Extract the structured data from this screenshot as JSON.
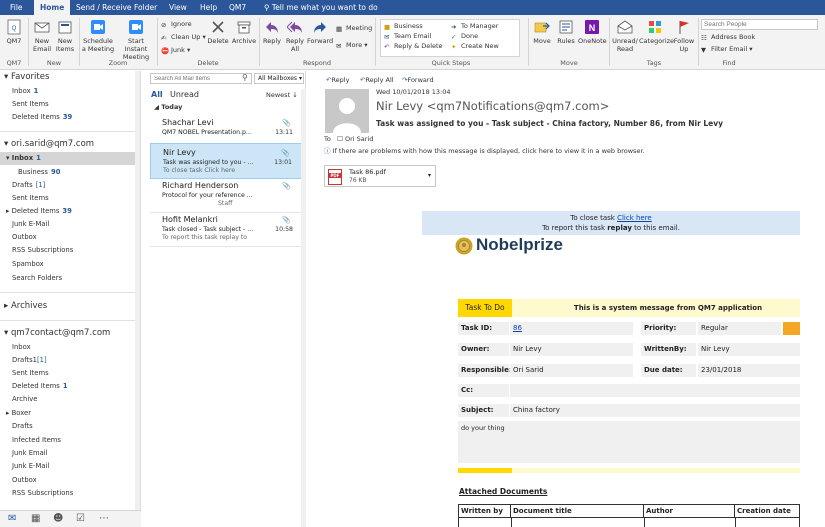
{
  "tabs": [
    "File",
    "Home",
    "Send / Receive",
    "Folder",
    "View",
    "Help",
    "QM7"
  ],
  "tell_me": "Tell me what you want to do",
  "ribbon": {
    "qm7": "QM7",
    "new_email": "New Email",
    "new_items": "New Items",
    "schedule_meeting": "Schedule a Meeting",
    "start_instant_meeting": "Start Instant Meeting",
    "ignore": "Ignore",
    "clean_up": "Clean Up",
    "junk": "Junk",
    "delete": "Delete",
    "archive": "Archive",
    "reply": "Reply",
    "reply_all": "Reply All",
    "forward": "Forward",
    "meeting": "Meeting",
    "more": "More",
    "quick_steps": [
      "Business",
      "Team Email",
      "Reply & Delete",
      "To Manager",
      "Done",
      "Create New"
    ],
    "move": "Move",
    "rules": "Rules",
    "onenote": "OneNote",
    "unread_read": "Unread/ Read",
    "categorize": "Categorize",
    "follow_up": "Follow Up",
    "search_people": "Search People",
    "address_book": "Address Book",
    "filter_email": "Filter Email",
    "groups": [
      "QM7",
      "New",
      "Zoom",
      "Delete",
      "Respond",
      "Quick Steps",
      "Move",
      "Tags",
      "Find"
    ]
  },
  "folders": {
    "favorites_header": "Favorites",
    "favorites": [
      {
        "name": "Inbox",
        "count": "1"
      },
      {
        "name": "Sent Items",
        "count": ""
      },
      {
        "name": "Deleted Items",
        "count": "39"
      }
    ],
    "account1": "ori.sarid@qm7.com",
    "account1_items": [
      {
        "name": "Inbox",
        "count": "1"
      },
      {
        "name": "Business",
        "count": "90"
      },
      {
        "name": "Drafts",
        "count": "[1]"
      },
      {
        "name": "Sent Items",
        "count": ""
      },
      {
        "name": "Deleted Items",
        "count": "39"
      },
      {
        "name": "Junk E-Mail",
        "count": ""
      },
      {
        "name": "Outbox",
        "count": ""
      },
      {
        "name": "RSS Subscriptions",
        "count": ""
      },
      {
        "name": "Spambox",
        "count": ""
      },
      {
        "name": "Search Folders",
        "count": ""
      }
    ],
    "archives": "Archives",
    "account2": "qm7contact@qm7.com",
    "account2_items": [
      {
        "name": "Inbox",
        "count": ""
      },
      {
        "name": "Drafts1",
        "count": "[1]"
      },
      {
        "name": "Sent Items",
        "count": ""
      },
      {
        "name": "Deleted Items",
        "count": "1"
      },
      {
        "name": "Archive",
        "count": ""
      },
      {
        "name": "Boxer",
        "count": ""
      },
      {
        "name": "Drafts",
        "count": ""
      },
      {
        "name": "Infected Items",
        "count": ""
      },
      {
        "name": "Junk Email",
        "count": ""
      },
      {
        "name": "Junk E-Mail",
        "count": ""
      },
      {
        "name": "Outbox",
        "count": ""
      },
      {
        "name": "RSS Subscriptions",
        "count": ""
      }
    ]
  },
  "list": {
    "search_placeholder": "Search All Mail Items",
    "scope": "All Mailboxes",
    "filter_all": "All",
    "filter_unread": "Unread",
    "sort": "Newest",
    "group_today": "Today",
    "messages": [
      {
        "from": "Shachar Levi",
        "subject": "QM7 NOBEL Presentation.p...",
        "preview": "",
        "time": "13:11"
      },
      {
        "from": "Nir Levy",
        "subject": "Task was assigned to you - ...",
        "preview": "To close task Click here",
        "time": "13:01"
      },
      {
        "from": "Richard Henderson",
        "subject": "Protocol for your reference ...",
        "preview": "Staff",
        "time": ""
      },
      {
        "from": "Hofit Melankri",
        "subject": "Task closed - Task subject - ...",
        "preview": "To report this task replay to",
        "time": "10:58"
      }
    ]
  },
  "reader": {
    "reply": "Reply",
    "reply_all": "Reply All",
    "forward": "Forward",
    "date": "Wed 10/01/2018 13:04",
    "sender": "Nir Levy <qm7Notifications@qm7.com>",
    "subject": "Task was assigned to you - Task subject - China factory, Number 86, from Nir Levy",
    "to_label": "To",
    "to": "Ori Sarid",
    "info_bar": "If there are problems with how this message is displayed, click here to view it in a web browser.",
    "attachment_name": "Task 86.pdf",
    "attachment_size": "76 KB",
    "body": {
      "close_prefix": "To close task ",
      "close_link": "Click here",
      "report_prefix": "To report this task ",
      "report_bold": "replay",
      "report_suffix": " to this email.",
      "logo": "Nobelprize",
      "task_to_do": "Task To Do",
      "system_msg": "This is a system message from QM7 application",
      "task_id_label": "Task ID:",
      "task_id": "86",
      "priority_label": "Priority:",
      "priority": "Regular",
      "owner_label": "Owner:",
      "owner": "Nir Levy",
      "written_by_label": "WrittenBy:",
      "written_by": "Nir Levy",
      "responsible_label": "Responsible:",
      "responsible": "Ori Sarid",
      "due_date_label": "Due date:",
      "due_date": "23/01/2018",
      "cc_label": "Cc:",
      "subject_label": "Subject:",
      "subject": "China factory",
      "description": "do your thing",
      "attached_docs": "Attached Documents",
      "doc_headers": [
        "Written by",
        "Document title",
        "Author",
        "Creation date"
      ]
    }
  },
  "colors": {
    "accent": "#2b579a",
    "task_header": "#ffd800",
    "task_header_bg": "#fffacd",
    "priority_flag": "#f5a623"
  }
}
